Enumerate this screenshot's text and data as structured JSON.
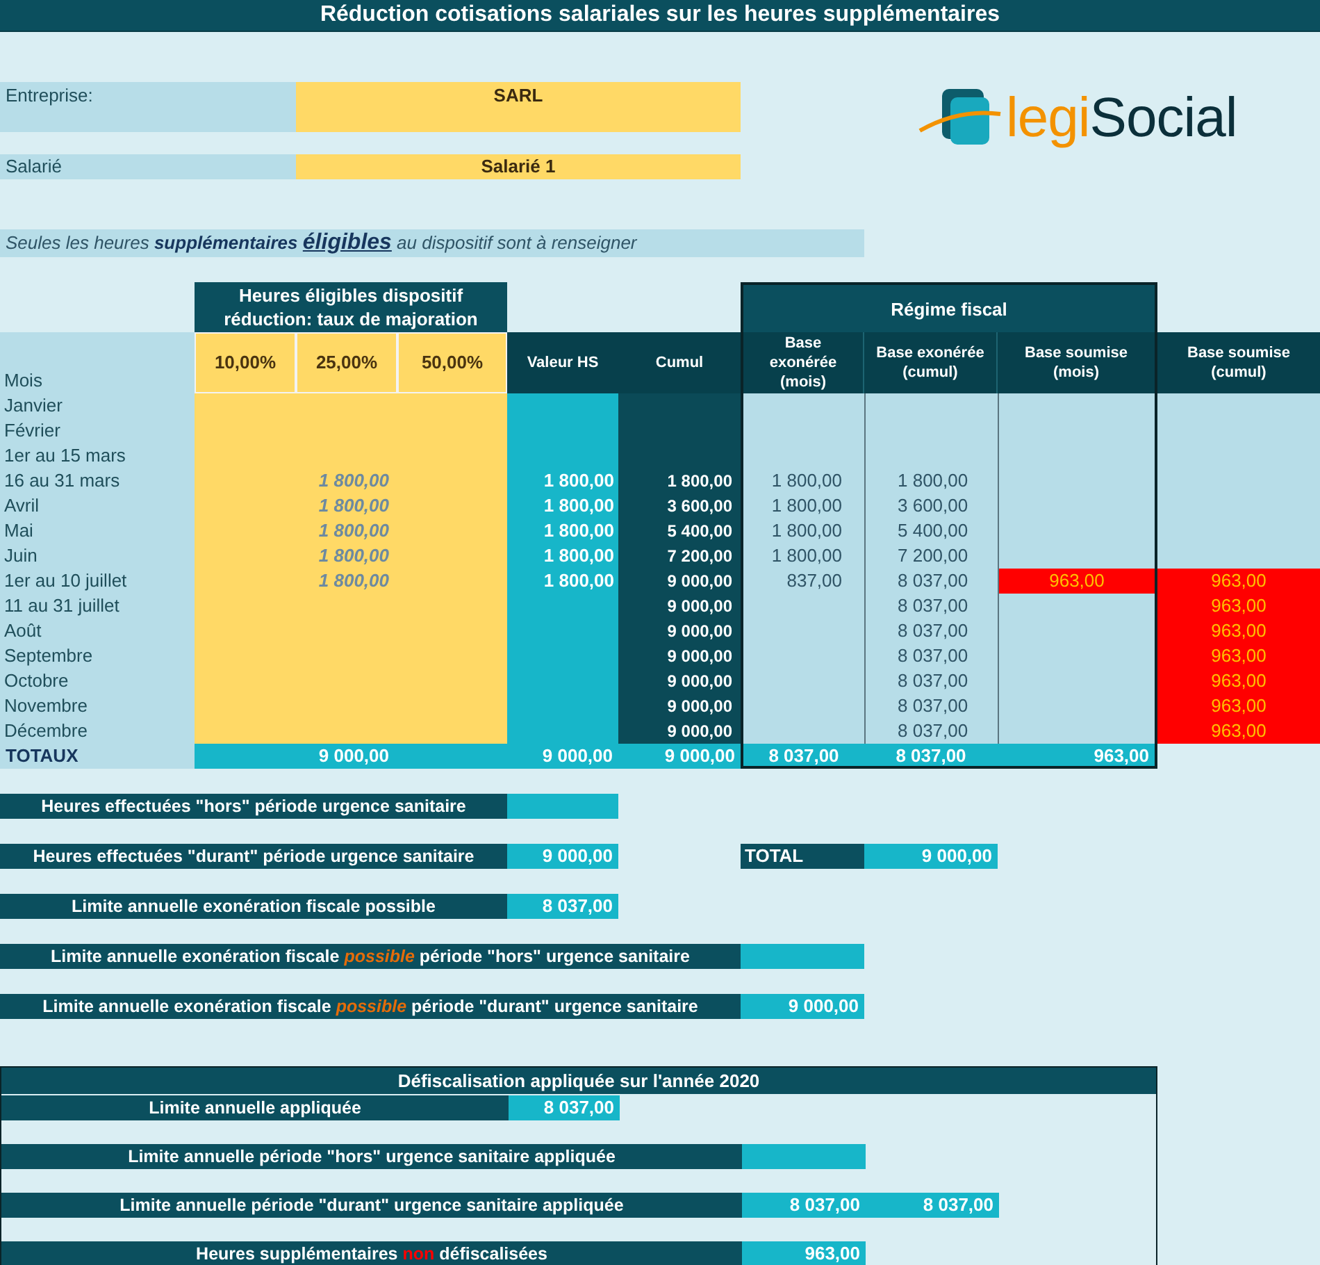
{
  "title": "Réduction cotisations salariales sur les heures supplémentaires",
  "entreprise": {
    "label": "Entreprise:",
    "value": "SARL"
  },
  "salarie": {
    "label": "Salarié",
    "value": "Salarié 1"
  },
  "logo": {
    "part_1": "legi",
    "part_2": "Social"
  },
  "notice": {
    "before": "Seules les heures",
    "bold": "supplémentaires",
    "emphasis": "éligibles",
    "after": "au dispositif sont à renseigner"
  },
  "table": {
    "group_header": "Heures éligibles dispositif réduction: taux de majoration",
    "regime_header": "Régime fiscal",
    "columns": [
      "Mois",
      "10,00%",
      "25,00%",
      "50,00%",
      "Valeur HS",
      "Cumul",
      "Base exonérée (mois)",
      "Base exonérée (cumul)",
      "Base soumise (mois)",
      "Base soumise (cumul)"
    ],
    "rows": [
      {
        "mois": "Janvier"
      },
      {
        "mois": "Février"
      },
      {
        "mois": "1er au 15 mars"
      },
      {
        "mois": "16 au 31 mars",
        "taux_25": "1 800,00",
        "valeur_hs": "1 800,00",
        "cumul": "1 800,00",
        "base_exoneree_mois": "1 800,00",
        "base_exoneree_cumul": "1 800,00"
      },
      {
        "mois": "Avril",
        "taux_25": "1 800,00",
        "valeur_hs": "1 800,00",
        "cumul": "3 600,00",
        "base_exoneree_mois": "1 800,00",
        "base_exoneree_cumul": "3 600,00"
      },
      {
        "mois": "Mai",
        "taux_25": "1 800,00",
        "valeur_hs": "1 800,00",
        "cumul": "5 400,00",
        "base_exoneree_mois": "1 800,00",
        "base_exoneree_cumul": "5 400,00"
      },
      {
        "mois": "Juin",
        "taux_25": "1 800,00",
        "valeur_hs": "1 800,00",
        "cumul": "7 200,00",
        "base_exoneree_mois": "1 800,00",
        "base_exoneree_cumul": "7 200,00"
      },
      {
        "mois": "1er au 10 juillet",
        "taux_25": "1 800,00",
        "valeur_hs": "1 800,00",
        "cumul": "9 000,00",
        "base_exoneree_mois": "837,00",
        "base_exoneree_cumul": "8 037,00",
        "base_soumise_mois": "963,00",
        "base_soumise_cumul": "963,00"
      },
      {
        "mois": "11 au 31 juillet",
        "cumul": "9 000,00",
        "base_exoneree_cumul": "8 037,00",
        "base_soumise_cumul": "963,00"
      },
      {
        "mois": "Août",
        "cumul": "9 000,00",
        "base_exoneree_cumul": "8 037,00",
        "base_soumise_cumul": "963,00"
      },
      {
        "mois": "Septembre",
        "cumul": "9 000,00",
        "base_exoneree_cumul": "8 037,00",
        "base_soumise_cumul": "963,00"
      },
      {
        "mois": "Octobre",
        "cumul": "9 000,00",
        "base_exoneree_cumul": "8 037,00",
        "base_soumise_cumul": "963,00"
      },
      {
        "mois": "Novembre",
        "cumul": "9 000,00",
        "base_exoneree_cumul": "8 037,00",
        "base_soumise_cumul": "963,00"
      },
      {
        "mois": "Décembre",
        "cumul": "9 000,00",
        "base_exoneree_cumul": "8 037,00",
        "base_soumise_cumul": "963,00"
      }
    ],
    "totals": {
      "mois": "TOTAUX",
      "taux_25": "9 000,00",
      "valeur_hs": "9 000,00",
      "cumul": "9 000,00",
      "base_exoneree_mois": "8 037,00",
      "base_exoneree_cumul": "8 037,00",
      "base_soumise_mois": "963,00"
    }
  },
  "summary": [
    {
      "kind": "short",
      "label": {
        "before": "Heures effectuées \"hors\" période urgence sanitaire"
      }
    },
    {
      "kind": "short",
      "label": {
        "before": "Heures effectuées \"durant\" période urgence sanitaire"
      },
      "value": "9 000,00",
      "total": {
        "label": "TOTAL",
        "value": "9 000,00"
      }
    },
    {
      "kind": "short",
      "label": {
        "before": "Limite annuelle exonération fiscale possible"
      },
      "value": "8 037,00"
    },
    {
      "kind": "long",
      "label": {
        "before": "Limite annuelle exonération fiscale",
        "highlight": "possible",
        "after": "période \"hors\" urgence sanitaire",
        "color": "#e46c0a"
      }
    },
    {
      "kind": "long",
      "label": {
        "before": "Limite annuelle exonération fiscale",
        "highlight": "possible",
        "after": "période \"durant\" urgence sanitaire",
        "color": "#e46c0a"
      },
      "value": "9 000,00"
    }
  ],
  "defiscalisation": {
    "title": "Défiscalisation appliquée sur l'année 2020",
    "rows": [
      {
        "kind": "short",
        "label": {
          "before": "Limite annuelle appliquée"
        },
        "value": "8 037,00"
      },
      {
        "kind": "long",
        "label": {
          "before": "Limite annuelle période \"hors\" urgence sanitaire appliquée"
        }
      },
      {
        "kind": "long",
        "label": {
          "before": "Limite annuelle période \"durant\" urgence sanitaire appliquée"
        },
        "value": "8 037,00",
        "extra": "8 037,00"
      },
      {
        "kind": "long",
        "label": {
          "before": "Heures supplémentaires",
          "highlight": "non",
          "after": "défiscalisées",
          "color": "#ff0000"
        },
        "value": "963,00"
      }
    ]
  }
}
